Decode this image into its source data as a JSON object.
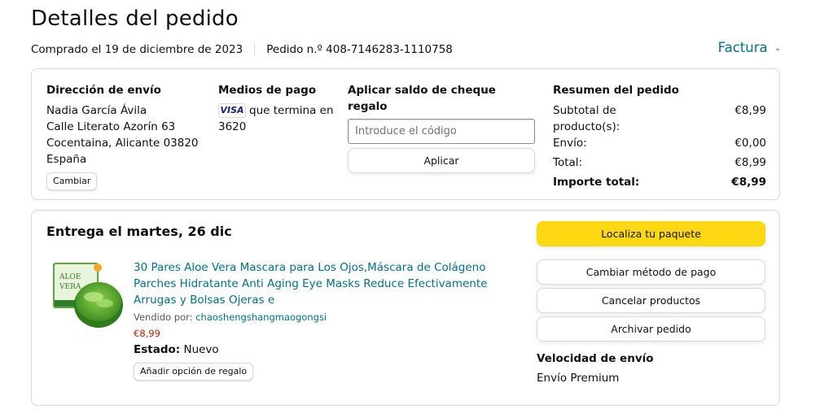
{
  "header": {
    "title": "Detalles del pedido",
    "purchased": "Comprado el 19 de diciembre de 2023",
    "order_number": "Pedido n.º 408-7146283-1110758",
    "invoice_label": "Factura"
  },
  "shipping_address": {
    "title": "Dirección de envío",
    "name": "Nadia García Ávila",
    "street": "Calle Literato Azorín 63",
    "city": "Cocentaina, Alicante 03820",
    "country": "España",
    "change_label": "Cambiar"
  },
  "payment": {
    "title": "Medios de pago",
    "card_brand": "VISA",
    "ending_text": "que termina en",
    "last_digits": "3620"
  },
  "gift_card": {
    "title": "Aplicar saldo de cheque regalo",
    "placeholder": "Introduce el código",
    "value": "",
    "apply_label": "Aplicar"
  },
  "summary": {
    "title": "Resumen del pedido",
    "rows": [
      {
        "label": "Subtotal de producto(s):",
        "value": "€8,99"
      },
      {
        "label": "Envío:",
        "value": "€0,00"
      },
      {
        "label": "Total:",
        "value": "€8,99"
      },
      {
        "label": "Importe total:",
        "value": "€8,99"
      }
    ]
  },
  "delivery": {
    "title": "Entrega el martes, 26 dic",
    "product": {
      "title": "30 Pares Aloe Vera Mascara para Los Ojos,Máscara de Colágeno Parches Hidratante Anti Aging Eye Masks Reduce Efectivamente Arrugas y Bolsas Ojeras e",
      "image_text_1": "ALOE",
      "image_text_2": "VERA",
      "seller_label": "Vendido por:",
      "seller": "chaoshengshangmaogongsi",
      "price": "€8,99",
      "status_label": "Estado:",
      "status_value": "Nuevo",
      "gift_label": "Añadir opción de regalo"
    },
    "actions": {
      "track": "Localiza tu paquete",
      "change_payment": "Cambiar método de pago",
      "cancel": "Cancelar productos",
      "archive": "Archivar pedido"
    },
    "shipping_speed_title": "Velocidad de envío",
    "shipping_speed_value": "Envío Premium"
  },
  "colors": {
    "link": "#007185",
    "primary_button": "#ffd814",
    "price": "#b12704",
    "border": "#d5d9d9"
  }
}
